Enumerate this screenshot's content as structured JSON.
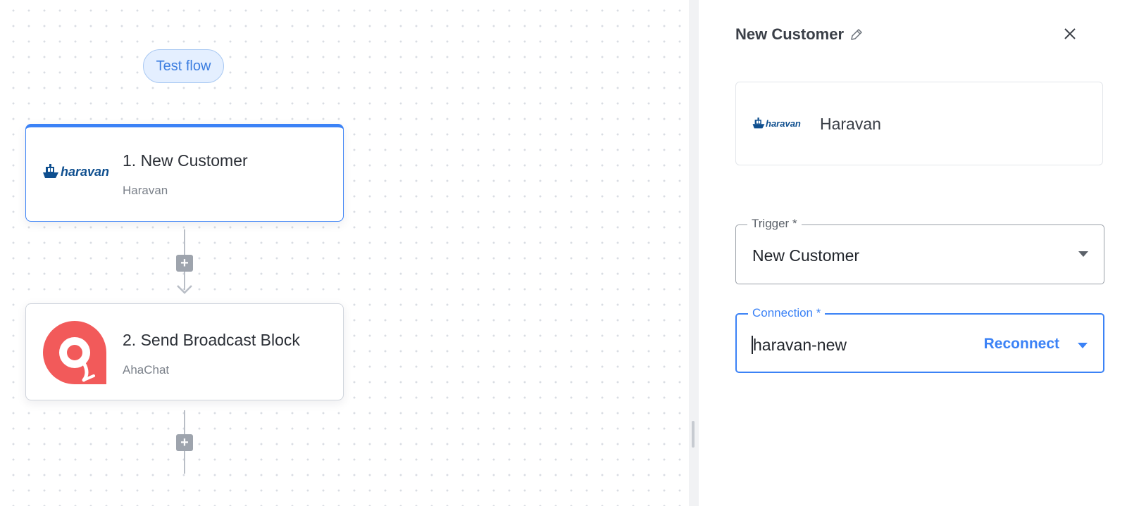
{
  "canvas": {
    "test_flow_label": "Test flow",
    "steps": [
      {
        "number_title": "1. New Customer",
        "app": "Haravan",
        "logo_text": "haravan"
      },
      {
        "number_title": "2. Send Broadcast Block",
        "app": "AhaChat"
      }
    ],
    "add_step_symbol": "+"
  },
  "panel": {
    "title": "New Customer",
    "app": {
      "name": "Haravan",
      "logo_text": "haravan"
    },
    "trigger": {
      "label": "Trigger *",
      "value": "New Customer"
    },
    "connection": {
      "label": "Connection *",
      "value": "haravan-new",
      "action": "Reconnect"
    }
  },
  "colors": {
    "accent": "#3b82f6",
    "ahachat_brand": "#f25a5a",
    "haravan_brand": "#0f4f8f"
  }
}
